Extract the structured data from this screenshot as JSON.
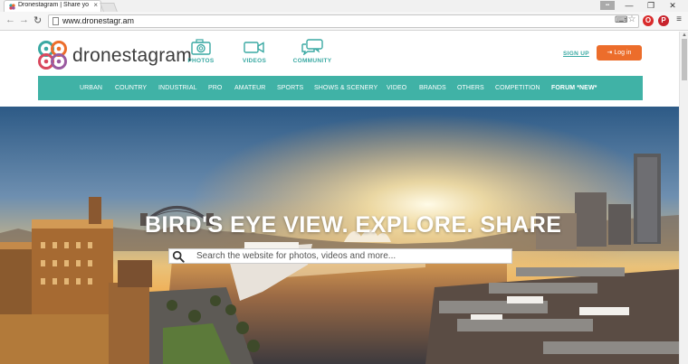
{
  "browser": {
    "tab_title": "Dronestagram | Share yo",
    "tab_close": "×",
    "url": "www.dronestagr.am",
    "window_buttons": [
      "—",
      "❐",
      "✕"
    ]
  },
  "site": {
    "brand": "dronestagram",
    "nav": [
      {
        "label": "PHOTOS",
        "icon": "camera-icon"
      },
      {
        "label": "VIDEOS",
        "icon": "video-camera-icon"
      },
      {
        "label": "COMMUNITY",
        "icon": "chat-bubbles-icon"
      }
    ],
    "signup_label": "SIGN UP",
    "login_label": "Log in",
    "categories": [
      "URBAN",
      "COUNTRY",
      "INDUSTRIAL",
      "PRO",
      "AMATEUR",
      "SPORTS",
      "SHOWS & SCENERY",
      "VIDEO",
      "BRANDS",
      "OTHERS",
      "COMPETITION",
      "FORUM *NEW*"
    ]
  },
  "hero": {
    "headline": "BIRD'S EYE VIEW. EXPLORE. SHARE",
    "search_placeholder": "Search the website for photos, videos and more..."
  },
  "colors": {
    "accent": "#40b2a6",
    "login": "#ec6d2b"
  }
}
